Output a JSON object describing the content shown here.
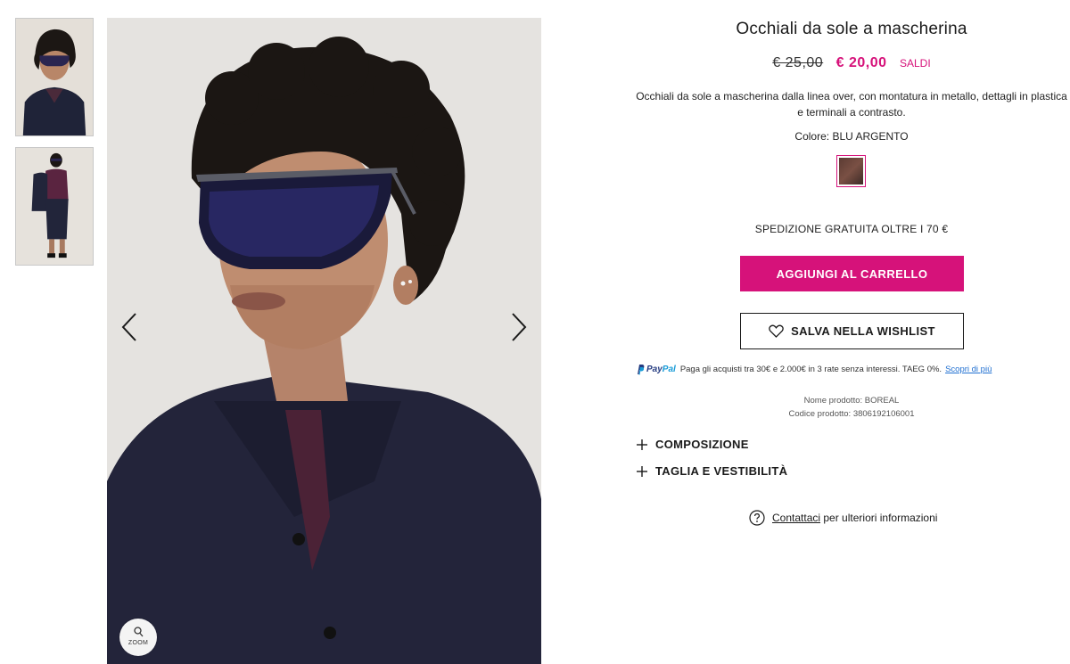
{
  "gallery": {
    "thumbnails": [
      {
        "name": "thumbnail-1"
      },
      {
        "name": "thumbnail-2"
      }
    ],
    "zoom_label": "ZOOM"
  },
  "product": {
    "title": "Occhiali da sole a mascherina",
    "price_old": "€ 25,00",
    "price_new": "€ 20,00",
    "price_badge": "SALDI",
    "description": "Occhiali da sole a mascherina dalla linea over, con montatura in metallo, dettagli in plastica e terminali a contrasto.",
    "color_line": "Colore: BLU ARGENTO",
    "shipping_note": "SPEDIZIONE GRATUITA OLTRE I 70 €",
    "add_to_cart_label": "AGGIUNGI AL CARRELLO",
    "wishlist_label": "SALVA NELLA WISHLIST",
    "paypal": {
      "brand_pay": "Pay",
      "brand_pal": "Pal",
      "text": "Paga gli acquisti tra 30€ e 2.000€ in 3 rate senza interessi. TAEG 0%.",
      "link": "Scopri di più"
    },
    "meta_name": "Nome prodotto: BOREAL",
    "meta_code": "Codice prodotto:  3806192106001",
    "accordions": [
      {
        "label": "COMPOSIZIONE"
      },
      {
        "label": "TAGLIA E VESTIBILITÀ"
      }
    ],
    "contact_link": "Contattaci",
    "contact_text": "per ulteriori informazioni"
  },
  "colors": {
    "accent": "#d6127a",
    "paypal_blue": "#253b80",
    "paypal_light": "#179bd7",
    "swatch": "#5b3b33"
  },
  "icons": {
    "prev": "chevron-left-icon",
    "next": "chevron-right-icon",
    "zoom": "magnifier-icon",
    "wishlist": "heart-icon",
    "accordion": "plus-icon",
    "help": "question-circle-icon",
    "paypal": "paypal-logo"
  }
}
